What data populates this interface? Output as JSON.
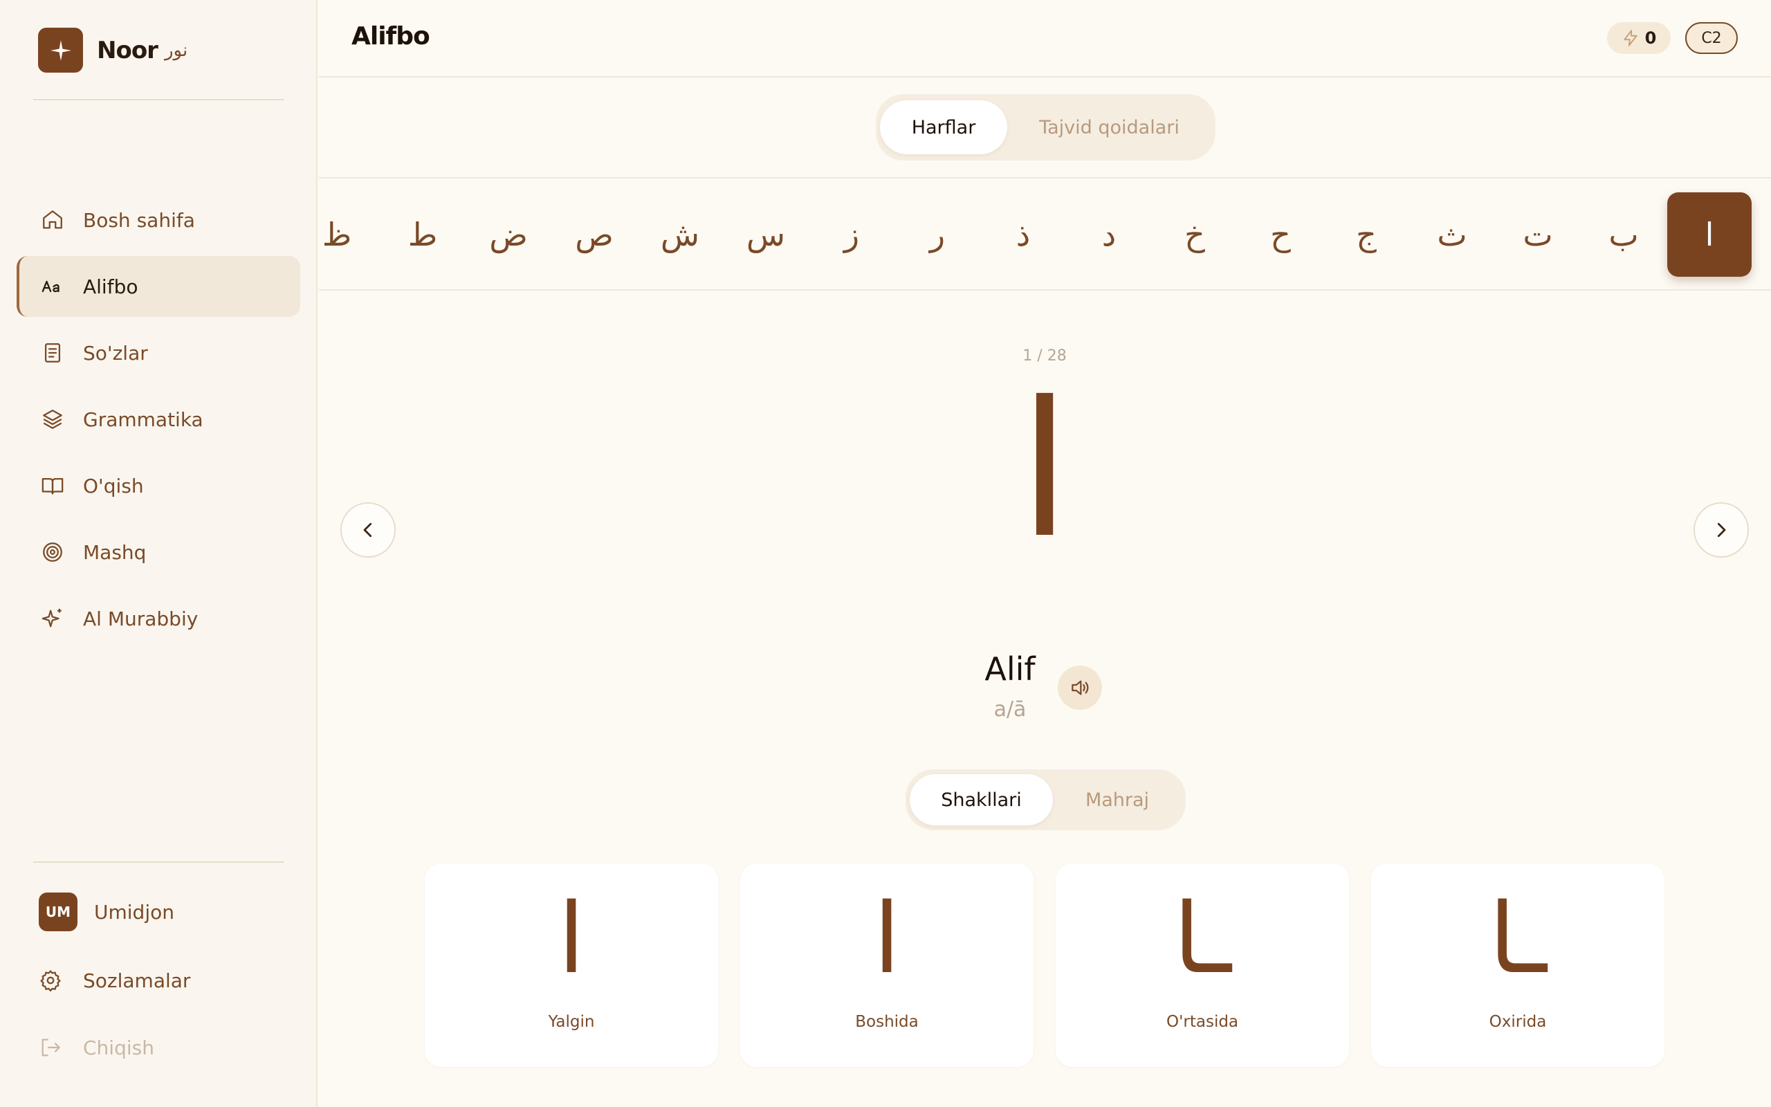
{
  "brand": {
    "name": "Noor",
    "arabic": "نور"
  },
  "nav": [
    {
      "id": "home",
      "label": "Bosh sahifa",
      "icon": "home-icon"
    },
    {
      "id": "alphabet",
      "label": "Alifbo",
      "icon": "alphabet-icon",
      "active": true
    },
    {
      "id": "words",
      "label": "So'zlar",
      "icon": "document-icon"
    },
    {
      "id": "grammar",
      "label": "Grammatika",
      "icon": "layers-icon"
    },
    {
      "id": "reading",
      "label": "O'qish",
      "icon": "book-icon"
    },
    {
      "id": "practice",
      "label": "Mashq",
      "icon": "target-icon"
    },
    {
      "id": "tutor",
      "label": "Al Murabbiy",
      "icon": "sparkle-icon"
    }
  ],
  "user": {
    "initials": "UM",
    "name": "Umidjon"
  },
  "settings": {
    "label": "Sozlamalar"
  },
  "logout": {
    "label": "Chiqish"
  },
  "header": {
    "title": "Alifbo",
    "xp": "0",
    "level": "C2"
  },
  "top_tabs": [
    {
      "label": "Harflar",
      "active": true
    },
    {
      "label": "Tajvid qoidalari",
      "active": false
    }
  ],
  "letters": [
    "ا",
    "ب",
    "ت",
    "ث",
    "ج",
    "ح",
    "خ",
    "د",
    "ذ",
    "ر",
    "ز",
    "س",
    "ش",
    "ص",
    "ض",
    "ط",
    "ظ"
  ],
  "selected_index": 0,
  "current": {
    "counter": "1 / 28",
    "glyph": "ا",
    "name": "Alif",
    "translit": "a/ā"
  },
  "detail_tabs": [
    {
      "label": "Shakllari",
      "active": true
    },
    {
      "label": "Mahraj",
      "active": false
    }
  ],
  "forms": [
    {
      "glyph": "ا",
      "label": "Yalgin"
    },
    {
      "glyph": "ا",
      "label": "Boshida"
    },
    {
      "glyph": "ـا",
      "label": "O'rtasida"
    },
    {
      "glyph": "ـا",
      "label": "Oxirida"
    }
  ],
  "colors": {
    "brand": "#7a4320",
    "accent_text": "#7a4a28",
    "background": "#fdfaf4"
  }
}
